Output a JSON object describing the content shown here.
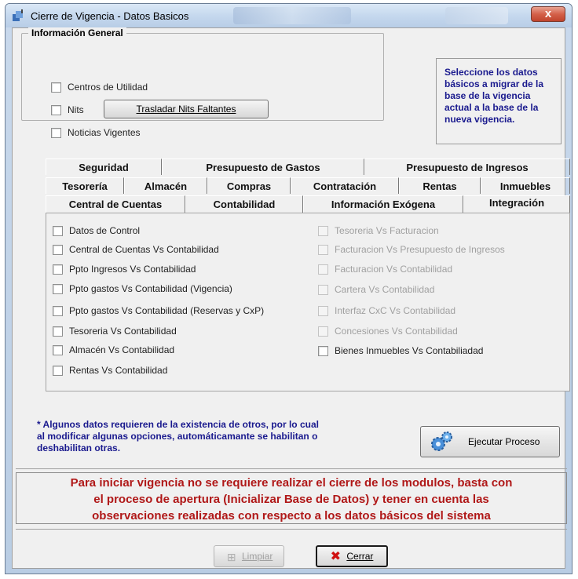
{
  "window": {
    "title": "Cierre de Vigencia - Datos Basicos",
    "close_glyph": "x"
  },
  "general": {
    "legend": "Información General",
    "items": [
      {
        "label": "Centros de Utilidad",
        "checked": false
      },
      {
        "label": "Nits",
        "checked": false
      },
      {
        "label": "Noticias Vigentes",
        "checked": false
      }
    ],
    "transfer_button": "Trasladar Nits Faltantes"
  },
  "info_text": "Seleccione los datos básicos a migrar de la base de la vigencia actual a la base de la nueva vigencia.",
  "tabs": {
    "row1": [
      "Seguridad",
      "Presupuesto de Gastos",
      "Presupuesto de Ingresos"
    ],
    "row2": [
      "Tesorería",
      "Almacén",
      "Compras",
      "Contratación",
      "Rentas",
      "Inmuebles"
    ],
    "row3": [
      "Central de Cuentas",
      "Contabilidad",
      "Información Exógena",
      "Integración"
    ],
    "active": "Integración"
  },
  "integracion": {
    "left": [
      {
        "label": "Datos de Control",
        "enabled": true
      },
      {
        "label": "Central de Cuentas Vs Contabilidad",
        "enabled": true
      },
      {
        "label": "Ppto Ingresos Vs Contabilidad",
        "enabled": true
      },
      {
        "label": "Ppto gastos Vs Contabilidad (Vigencia)",
        "enabled": true
      },
      {
        "label": "Ppto gastos Vs Contabilidad (Reservas y CxP)",
        "enabled": true
      },
      {
        "label": "Tesoreria Vs Contabilidad",
        "enabled": true
      },
      {
        "label": "Almacén Vs Contabilidad",
        "enabled": true
      },
      {
        "label": "Rentas Vs Contabilidad",
        "enabled": true
      }
    ],
    "right": [
      {
        "label": "Tesoreria Vs Facturacion",
        "enabled": false
      },
      {
        "label": "Facturacion Vs Presupuesto de Ingresos",
        "enabled": false
      },
      {
        "label": "Facturacion Vs Contabilidad",
        "enabled": false
      },
      {
        "label": "Cartera Vs Contabilidad",
        "enabled": false
      },
      {
        "label": "Interfaz CxC Vs Contabilidad",
        "enabled": false
      },
      {
        "label": "Concesiones Vs Contabilidad",
        "enabled": false
      },
      {
        "label": "Bienes Inmuebles Vs Contabiliadad",
        "enabled": true
      }
    ]
  },
  "note": {
    "line1": "* Algunos datos requieren de la existencia de otros, por lo cual",
    "line2": "al modificar algunas opciones, automáticamante se habilitan o",
    "line3": "deshabilitan otras."
  },
  "run_button": "Ejecutar Proceso",
  "warning": {
    "line1": "Para iniciar vigencia no se requiere realizar el cierre de los modulos, basta con",
    "line2": "el proceso de apertura (Inicializar Base de Datos) y tener en cuenta las",
    "line3": "observaciones realizadas con respecto a los datos básicos del sistema"
  },
  "buttons": {
    "clear": "Limpiar",
    "close": "Cerrar"
  },
  "colors": {
    "info_text": "#1a1a8e",
    "warning_text": "#b01818",
    "close_x": "#d01010"
  }
}
